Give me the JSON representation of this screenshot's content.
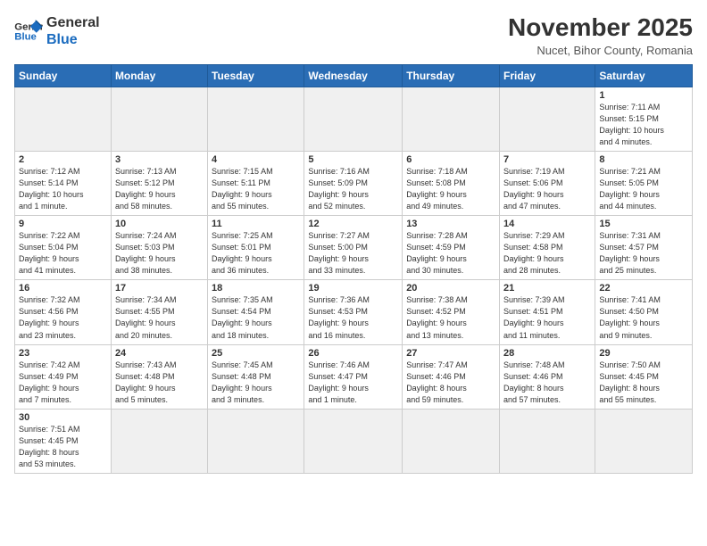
{
  "logo": {
    "line1": "General",
    "line2": "Blue"
  },
  "header": {
    "month": "November 2025",
    "location": "Nucet, Bihor County, Romania"
  },
  "weekdays": [
    "Sunday",
    "Monday",
    "Tuesday",
    "Wednesday",
    "Thursday",
    "Friday",
    "Saturday"
  ],
  "weeks": [
    [
      {
        "num": "",
        "info": ""
      },
      {
        "num": "",
        "info": ""
      },
      {
        "num": "",
        "info": ""
      },
      {
        "num": "",
        "info": ""
      },
      {
        "num": "",
        "info": ""
      },
      {
        "num": "",
        "info": ""
      },
      {
        "num": "1",
        "info": "Sunrise: 7:11 AM\nSunset: 5:15 PM\nDaylight: 10 hours\nand 4 minutes."
      }
    ],
    [
      {
        "num": "2",
        "info": "Sunrise: 7:12 AM\nSunset: 5:14 PM\nDaylight: 10 hours\nand 1 minute."
      },
      {
        "num": "3",
        "info": "Sunrise: 7:13 AM\nSunset: 5:12 PM\nDaylight: 9 hours\nand 58 minutes."
      },
      {
        "num": "4",
        "info": "Sunrise: 7:15 AM\nSunset: 5:11 PM\nDaylight: 9 hours\nand 55 minutes."
      },
      {
        "num": "5",
        "info": "Sunrise: 7:16 AM\nSunset: 5:09 PM\nDaylight: 9 hours\nand 52 minutes."
      },
      {
        "num": "6",
        "info": "Sunrise: 7:18 AM\nSunset: 5:08 PM\nDaylight: 9 hours\nand 49 minutes."
      },
      {
        "num": "7",
        "info": "Sunrise: 7:19 AM\nSunset: 5:06 PM\nDaylight: 9 hours\nand 47 minutes."
      },
      {
        "num": "8",
        "info": "Sunrise: 7:21 AM\nSunset: 5:05 PM\nDaylight: 9 hours\nand 44 minutes."
      }
    ],
    [
      {
        "num": "9",
        "info": "Sunrise: 7:22 AM\nSunset: 5:04 PM\nDaylight: 9 hours\nand 41 minutes."
      },
      {
        "num": "10",
        "info": "Sunrise: 7:24 AM\nSunset: 5:03 PM\nDaylight: 9 hours\nand 38 minutes."
      },
      {
        "num": "11",
        "info": "Sunrise: 7:25 AM\nSunset: 5:01 PM\nDaylight: 9 hours\nand 36 minutes."
      },
      {
        "num": "12",
        "info": "Sunrise: 7:27 AM\nSunset: 5:00 PM\nDaylight: 9 hours\nand 33 minutes."
      },
      {
        "num": "13",
        "info": "Sunrise: 7:28 AM\nSunset: 4:59 PM\nDaylight: 9 hours\nand 30 minutes."
      },
      {
        "num": "14",
        "info": "Sunrise: 7:29 AM\nSunset: 4:58 PM\nDaylight: 9 hours\nand 28 minutes."
      },
      {
        "num": "15",
        "info": "Sunrise: 7:31 AM\nSunset: 4:57 PM\nDaylight: 9 hours\nand 25 minutes."
      }
    ],
    [
      {
        "num": "16",
        "info": "Sunrise: 7:32 AM\nSunset: 4:56 PM\nDaylight: 9 hours\nand 23 minutes."
      },
      {
        "num": "17",
        "info": "Sunrise: 7:34 AM\nSunset: 4:55 PM\nDaylight: 9 hours\nand 20 minutes."
      },
      {
        "num": "18",
        "info": "Sunrise: 7:35 AM\nSunset: 4:54 PM\nDaylight: 9 hours\nand 18 minutes."
      },
      {
        "num": "19",
        "info": "Sunrise: 7:36 AM\nSunset: 4:53 PM\nDaylight: 9 hours\nand 16 minutes."
      },
      {
        "num": "20",
        "info": "Sunrise: 7:38 AM\nSunset: 4:52 PM\nDaylight: 9 hours\nand 13 minutes."
      },
      {
        "num": "21",
        "info": "Sunrise: 7:39 AM\nSunset: 4:51 PM\nDaylight: 9 hours\nand 11 minutes."
      },
      {
        "num": "22",
        "info": "Sunrise: 7:41 AM\nSunset: 4:50 PM\nDaylight: 9 hours\nand 9 minutes."
      }
    ],
    [
      {
        "num": "23",
        "info": "Sunrise: 7:42 AM\nSunset: 4:49 PM\nDaylight: 9 hours\nand 7 minutes."
      },
      {
        "num": "24",
        "info": "Sunrise: 7:43 AM\nSunset: 4:48 PM\nDaylight: 9 hours\nand 5 minutes."
      },
      {
        "num": "25",
        "info": "Sunrise: 7:45 AM\nSunset: 4:48 PM\nDaylight: 9 hours\nand 3 minutes."
      },
      {
        "num": "26",
        "info": "Sunrise: 7:46 AM\nSunset: 4:47 PM\nDaylight: 9 hours\nand 1 minute."
      },
      {
        "num": "27",
        "info": "Sunrise: 7:47 AM\nSunset: 4:46 PM\nDaylight: 8 hours\nand 59 minutes."
      },
      {
        "num": "28",
        "info": "Sunrise: 7:48 AM\nSunset: 4:46 PM\nDaylight: 8 hours\nand 57 minutes."
      },
      {
        "num": "29",
        "info": "Sunrise: 7:50 AM\nSunset: 4:45 PM\nDaylight: 8 hours\nand 55 minutes."
      }
    ],
    [
      {
        "num": "30",
        "info": "Sunrise: 7:51 AM\nSunset: 4:45 PM\nDaylight: 8 hours\nand 53 minutes."
      },
      {
        "num": "",
        "info": ""
      },
      {
        "num": "",
        "info": ""
      },
      {
        "num": "",
        "info": ""
      },
      {
        "num": "",
        "info": ""
      },
      {
        "num": "",
        "info": ""
      },
      {
        "num": "",
        "info": ""
      }
    ]
  ]
}
